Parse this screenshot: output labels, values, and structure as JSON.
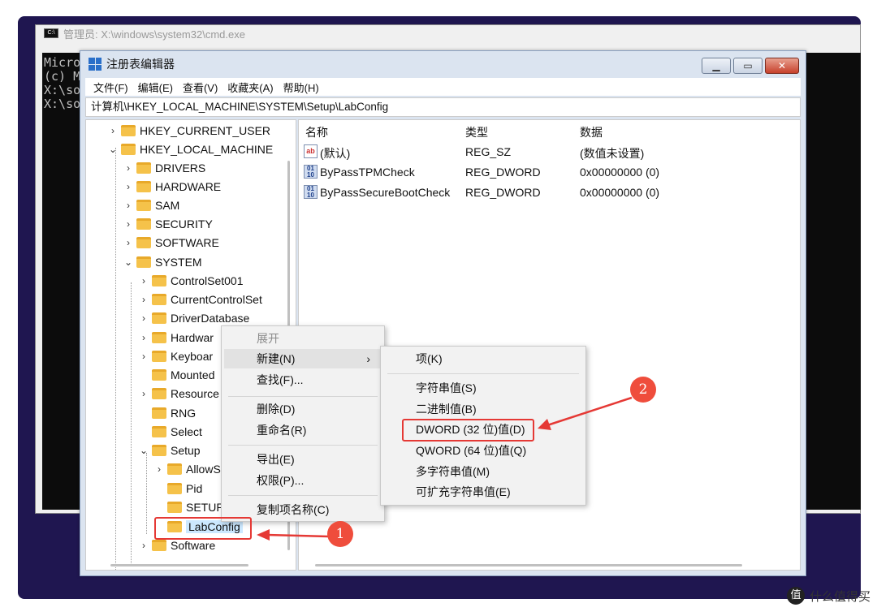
{
  "cmd": {
    "title": "管理员: X:\\windows\\system32\\cmd.exe",
    "lines": [
      "Micro",
      "(c) M",
      "",
      "X:\\so",
      "",
      "X:\\so"
    ]
  },
  "regedit": {
    "title": "注册表编辑器",
    "menu": [
      "文件(F)",
      "编辑(E)",
      "查看(V)",
      "收藏夹(A)",
      "帮助(H)"
    ],
    "address": "计算机\\HKEY_LOCAL_MACHINE\\SYSTEM\\Setup\\LabConfig",
    "tree": [
      {
        "label": "HKEY_CURRENT_USER",
        "arrow": "›"
      },
      {
        "label": "HKEY_LOCAL_MACHINE",
        "arrow": "⌄"
      },
      {
        "label": "DRIVERS",
        "arrow": "›"
      },
      {
        "label": "HARDWARE",
        "arrow": "›"
      },
      {
        "label": "SAM",
        "arrow": "›"
      },
      {
        "label": "SECURITY",
        "arrow": "›"
      },
      {
        "label": "SOFTWARE",
        "arrow": "›"
      },
      {
        "label": "SYSTEM",
        "arrow": "⌄"
      },
      {
        "label": "ControlSet001",
        "arrow": "›"
      },
      {
        "label": "CurrentControlSet",
        "arrow": "›"
      },
      {
        "label": "DriverDatabase",
        "arrow": "›"
      },
      {
        "label": "Hardwar",
        "arrow": "›"
      },
      {
        "label": "Keyboar",
        "arrow": "›"
      },
      {
        "label": "Mounted",
        "arrow": ""
      },
      {
        "label": "Resource",
        "arrow": "›"
      },
      {
        "label": "RNG",
        "arrow": ""
      },
      {
        "label": "Select",
        "arrow": ""
      },
      {
        "label": "Setup",
        "arrow": "⌄"
      },
      {
        "label": "AllowS",
        "arrow": "›"
      },
      {
        "label": "Pid",
        "arrow": ""
      },
      {
        "label": "SETUP",
        "arrow": ""
      },
      {
        "label": "LabConfig",
        "arrow": ""
      },
      {
        "label": "Software",
        "arrow": "›"
      }
    ],
    "columns": {
      "name": "名称",
      "type": "类型",
      "data": "数据"
    },
    "values": [
      {
        "icon": "ab",
        "name": "(默认)",
        "type": "REG_SZ",
        "data": "(数值未设置)"
      },
      {
        "icon": "bin",
        "name": "ByPassTPMCheck",
        "type": "REG_DWORD",
        "data": "0x00000000 (0)"
      },
      {
        "icon": "bin",
        "name": "ByPassSecureBootCheck",
        "type": "REG_DWORD",
        "data": "0x00000000 (0)"
      }
    ]
  },
  "context_menu": {
    "items": [
      "展开",
      "新建(N)",
      "查找(F)...",
      "删除(D)",
      "重命名(R)",
      "导出(E)",
      "权限(P)...",
      "复制项名称(C)"
    ],
    "submenu_arrow": "›"
  },
  "new_submenu": {
    "items": [
      "项(K)",
      "字符串值(S)",
      "二进制值(B)",
      "DWORD (32 位)值(D)",
      "QWORD (64 位)值(Q)",
      "多字符串值(M)",
      "可扩充字符串值(E)"
    ]
  },
  "annotations": {
    "badge1": "1",
    "badge2": "2",
    "color": "#e53935"
  },
  "watermark": {
    "logo": "值",
    "text": "什么值得买"
  }
}
